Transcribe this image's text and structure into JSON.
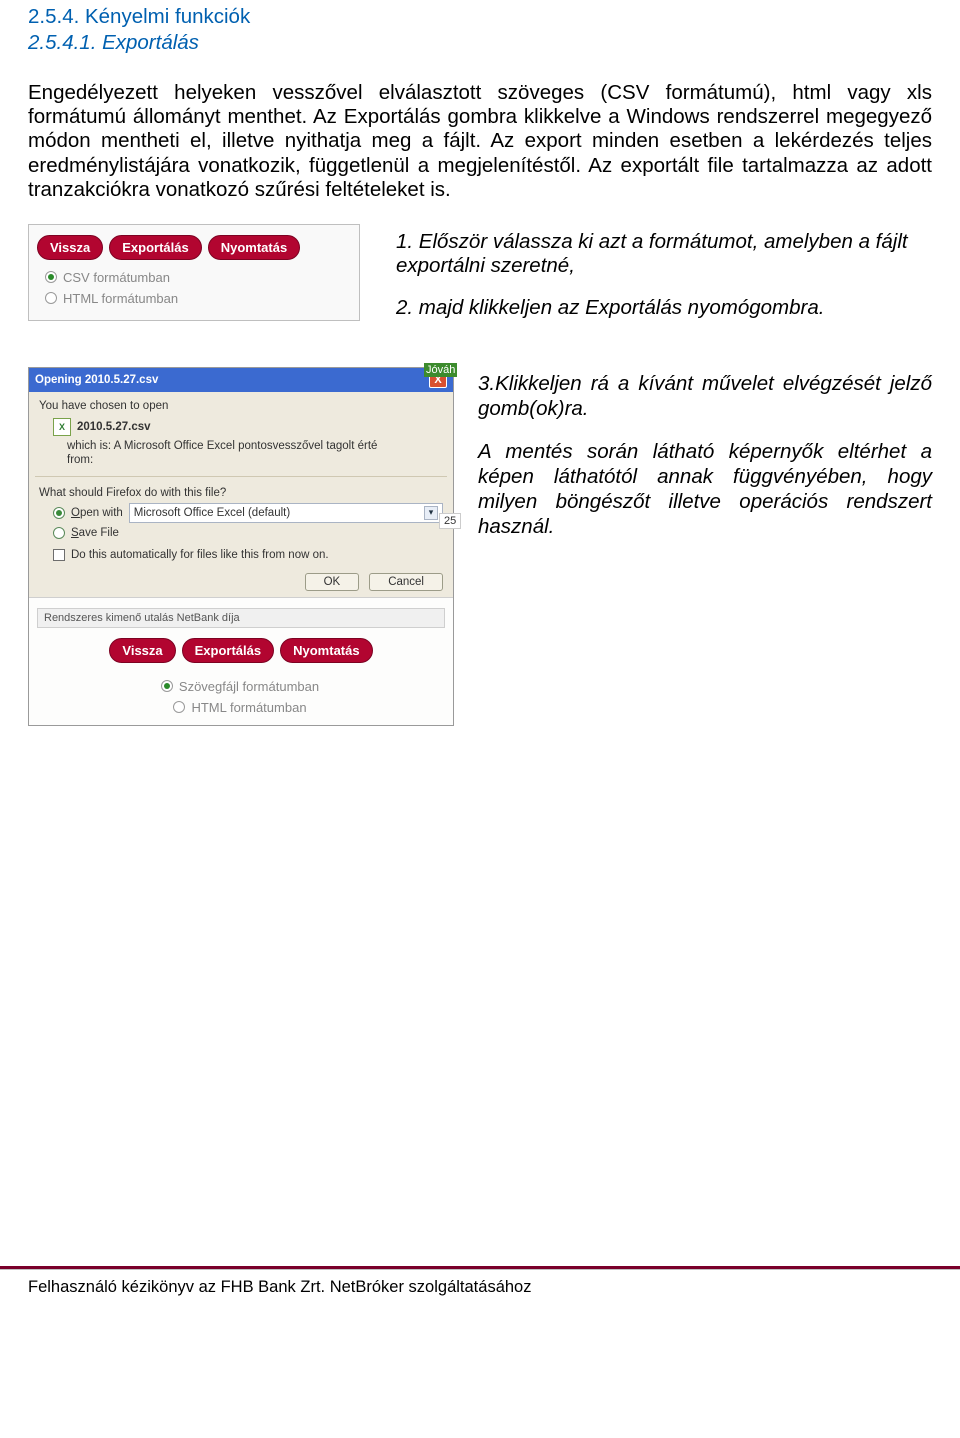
{
  "headings": {
    "h254": "2.5.4. Kényelmi funkciók",
    "h2541": "2.5.4.1. Exportálás"
  },
  "paragraph": "Engedélyezett helyeken vesszővel elválasztott szöveges (CSV formátumú), html vagy xls formátumú állományt menthet. Az Exportálás gombra klikkelve a Windows rendszerrel megegyező módon mentheti el, illetve nyithatja meg a fájlt. Az export minden esetben a lekérdezés teljes eredménylistájára vonatkozik, függetlenül a megjelenítéstől. Az exportált file tartalmazza az adott tranzakciókra vonatkozó szűrési feltételeket is.",
  "fig1": {
    "buttons": {
      "back": "Vissza",
      "export": "Exportálás",
      "print": "Nyomtatás"
    },
    "radios": {
      "csv": "CSV formátumban",
      "html": "HTML formátumban"
    }
  },
  "steps1": {
    "s1": "1. Először válassza ki azt a formátumot, amelyben a fájlt exportálni szeretné,",
    "s2": "2. majd klikkeljen az Exportálás nyomógombra."
  },
  "fig2": {
    "title": "Opening 2010.5.27.csv",
    "chosen": "You have chosen to open",
    "filename": "2010.5.27.csv",
    "which": "which is:  A Microsoft Office Excel pontosvesszővel tagolt érté",
    "from": "from:",
    "question": "What should Firefox do with this file?",
    "open": "Open with",
    "combo": "Microsoft Office Excel (default)",
    "save": "Save File",
    "auto": "Do this automatically for files like this from now on.",
    "ok": "OK",
    "cancel": "Cancel",
    "stub_green": "Jóváh",
    "stub_num": "25",
    "lower_stripe": "Rendszeres kimenő utalás NetBank díja",
    "lower_buttons": {
      "back": "Vissza",
      "export": "Exportálás",
      "print": "Nyomtatás"
    },
    "lower_radios": {
      "txt": "Szövegfájl formátumban",
      "html": "HTML formátumban"
    }
  },
  "steps2": {
    "s3": "3.Klikkeljen rá a kívánt művelet elvégzését jelző gomb(ok)ra.",
    "s4": "A mentés során látható képernyők eltérhet a képen láthatótól annak függvényében, hogy milyen böngészőt illetve operációs rendszert használ."
  },
  "footer": "Felhasználó kézikönyv az FHB Bank Zrt. NetBróker szolgáltatásához"
}
